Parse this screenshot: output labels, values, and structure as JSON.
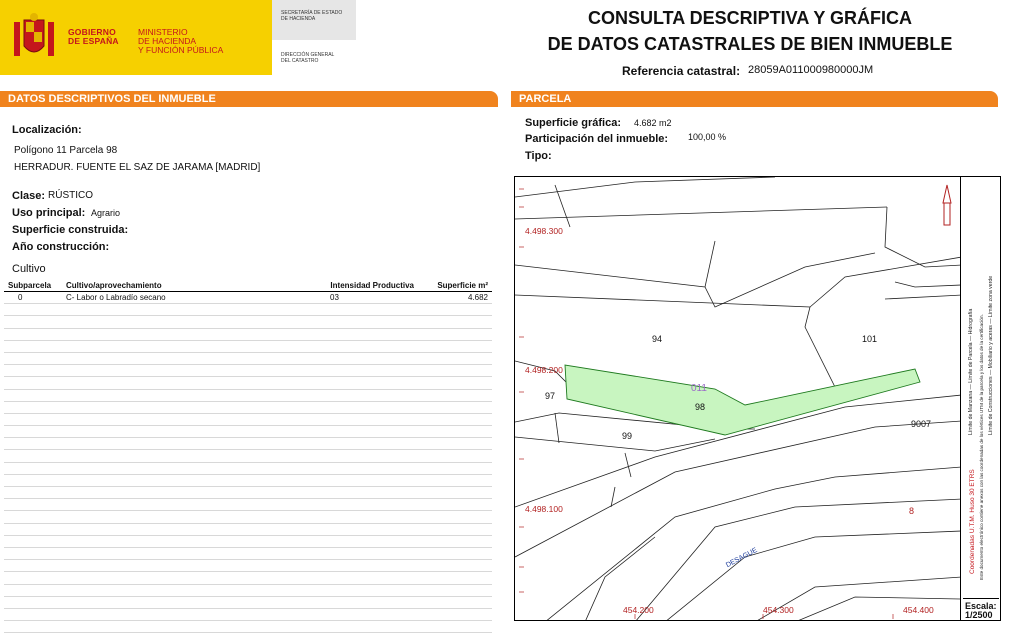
{
  "header": {
    "gov_line1": "GOBIERNO",
    "gov_line2": "DE ESPAÑA",
    "ministry_line1": "MINISTERIO",
    "ministry_line2": "DE HACIENDA",
    "ministry_line3": "Y FUNCIÓN PÚBLICA",
    "secretaria_line1": "SECRETARÍA DE ESTADO",
    "secretaria_line2": "DE HACIENDA",
    "direccion_line1": "DIRECCIÓN GENERAL",
    "direccion_line2": "DEL CATASTRO",
    "title_line1": "CONSULTA DESCRIPTIVA Y GRÁFICA",
    "title_line2": "DE DATOS CATASTRALES DE BIEN INMUEBLE",
    "ref_label": "Referencia catastral:",
    "ref_value": "28059A011000980000JM"
  },
  "left": {
    "section_prefix": "DATOS DESCRIPTIVOS DEL ",
    "section_bold": "INMUEBLE",
    "localizacion_label": "Localización:",
    "localizacion_line1": "Polígono 11 Parcela 98",
    "localizacion_line2": "HERRADUR. FUENTE EL SAZ DE JARAMA [MADRID]",
    "clase_label": "Clase:",
    "clase_value": "RÚSTICO",
    "uso_label": "Uso principal:",
    "uso_value": "Agrario",
    "superficie_label": "Superficie construida:",
    "anio_label": "Año construcción:",
    "cultivo_title": "Cultivo",
    "table_headers": [
      "Subparcela",
      "Cultivo/aprovechamiento",
      "Intensidad Productiva",
      "Superficie m²"
    ],
    "rows": [
      {
        "subparcela": "0",
        "cultivo": "C- Labor o Labradío secano",
        "intensidad": "03",
        "superficie": "4.682"
      }
    ]
  },
  "right": {
    "section_title": "PARCELA",
    "sup_grafica_label": "Superficie gráfica:",
    "sup_grafica_value": "4.682 m2",
    "participacion_label": "Participación del inmueble:",
    "participacion_value": "100,00 %",
    "tipo_label": "Tipo:"
  },
  "map": {
    "y_ticks": [
      "4.498.300",
      "4.498.200",
      "4.498.100"
    ],
    "x_ticks": [
      "454.200",
      "454.300",
      "454.400"
    ],
    "parcel_labels": [
      "94",
      "101",
      "97",
      "98",
      "99",
      "9007",
      "011"
    ],
    "red_label": "8",
    "road_label": "DESAGUE",
    "parcel_fill": "#c8f5c0",
    "tick_color": "#b22222"
  },
  "legend": {
    "coords_text": "Coordenadas U.T.M. Huso 30 ETRS",
    "doc_text": "Este documento electrónico contiene anexos con las coordenadas de los vértices UTM de la parcela y los datos de la certificación.",
    "items1": "Límite de Manzana — Límite de Parcela — Hidrografía",
    "items2": "Límite de Construcciones — Mobiliario y aceras — Límite zona verde",
    "scale_label": "Escala:",
    "scale_value": "1/2500"
  }
}
